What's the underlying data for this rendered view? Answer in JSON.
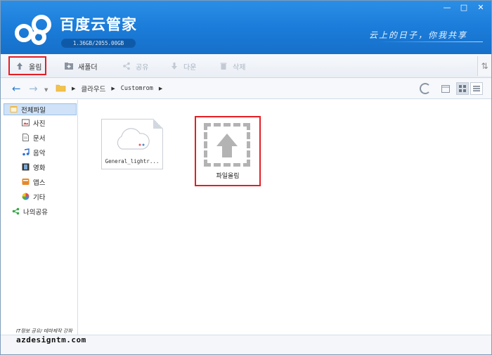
{
  "header": {
    "app_title": "百度云管家",
    "quota": "1.36GB/2055.00GB",
    "slogan": "云上的日子，你我共享",
    "window_controls": [
      "minimize-icon",
      "restore-icon",
      "close-icon"
    ]
  },
  "toolbar": {
    "upload_label": "올림",
    "new_folder_label": "새폴더",
    "share_label": "공유",
    "download_label": "다운",
    "delete_label": "삭제"
  },
  "address": {
    "crumbs": [
      "클라우드",
      "Customrom"
    ]
  },
  "sidebar": {
    "items": [
      {
        "label": "전체파일",
        "icon": "all-files-icon",
        "selected": true
      },
      {
        "label": "사진",
        "icon": "photo-icon"
      },
      {
        "label": "문서",
        "icon": "document-icon"
      },
      {
        "label": "음악",
        "icon": "music-icon"
      },
      {
        "label": "영화",
        "icon": "video-icon"
      },
      {
        "label": "앱스",
        "icon": "apps-icon"
      },
      {
        "label": "기타",
        "icon": "other-icon"
      },
      {
        "label": "나의공유",
        "icon": "my-share-icon"
      }
    ]
  },
  "content": {
    "files": [
      {
        "name": "General_lightr...",
        "icon": "cloud-file-icon"
      }
    ],
    "upload_tile_label": "파일올림"
  },
  "watermark": {
    "small_text": "IT정보 공유/ 테마제작 강좌",
    "site": "azdesigntm.com"
  },
  "colors": {
    "header_blue": "#1a7bd8",
    "highlight_red": "#e41e24",
    "selected_bg": "#cfe2f7"
  }
}
